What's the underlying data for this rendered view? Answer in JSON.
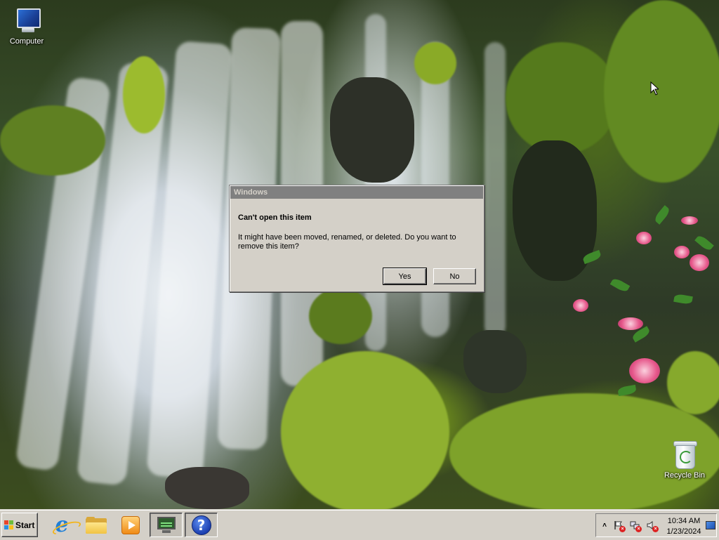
{
  "desktop": {
    "icons": [
      {
        "label": "Computer",
        "icon": "computer-icon"
      },
      {
        "label": "Recycle Bin",
        "icon": "recycle-bin-icon"
      }
    ]
  },
  "dialog": {
    "title": "Windows",
    "heading": "Can't open this item",
    "message": "It might have been moved, renamed, or deleted. Do you want to remove this item?",
    "yes_label": "Yes",
    "no_label": "No"
  },
  "taskbar": {
    "start_label": "Start",
    "pinned": [
      {
        "icon": "internet-explorer-icon"
      },
      {
        "icon": "file-explorer-icon"
      },
      {
        "icon": "media-player-icon"
      },
      {
        "icon": "monitor-icon"
      },
      {
        "icon": "help-icon"
      }
    ],
    "clock_time": "10:34 AM",
    "clock_date": "1/23/2024"
  },
  "colors": {
    "dialog_face": "#d4d0c8",
    "dialog_title_inactive": "#808080"
  }
}
